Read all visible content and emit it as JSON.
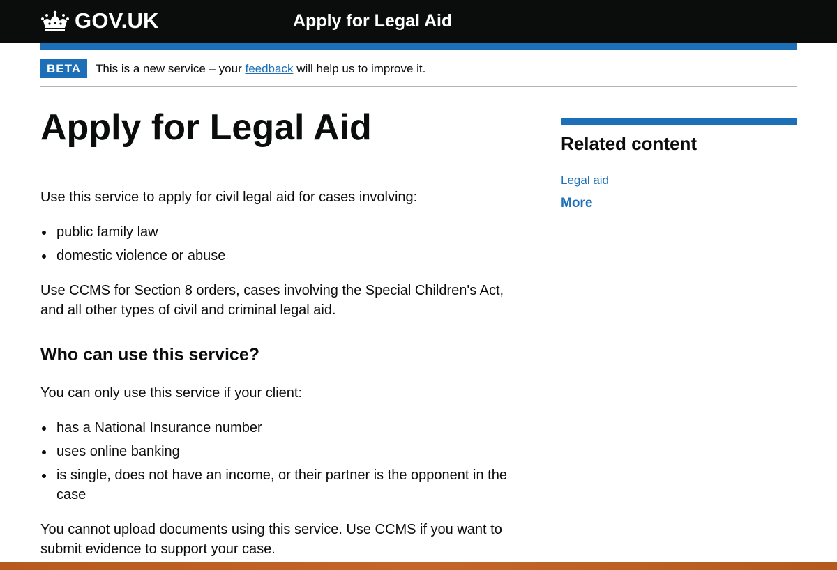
{
  "header": {
    "logo_text": "GOV.UK",
    "service_name": "Apply for Legal Aid"
  },
  "phase_banner": {
    "tag": "BETA",
    "text_before": "This is a new service – your ",
    "link": "feedback",
    "text_after": " will help us to improve it."
  },
  "main": {
    "title": "Apply for Legal Aid",
    "intro": "Use this service to apply for civil legal aid for cases involving:",
    "case_types": [
      "public family law",
      "domestic violence or abuse"
    ],
    "ccms_note": "Use CCMS for Section 8 orders, cases involving the Special Children's Act, and all other types of civil and criminal legal aid.",
    "who_heading": "Who can use this service?",
    "who_intro": "You can only use this service if your client:",
    "conditions": [
      "has a National Insurance number",
      "uses online banking",
      "is single, does not have an income, or their partner is the opponent in the case"
    ],
    "upload_note": "You cannot upload documents using this service. Use CCMS if you want to submit evidence to support your case."
  },
  "related": {
    "heading": "Related content",
    "links": [
      "Legal aid",
      "More"
    ]
  },
  "colors": {
    "header_bg": "#0b0c0c",
    "brand_blue": "#1d70b8",
    "text": "#0b0c0c",
    "link": "#1d70b8",
    "footer_strip": "#c4662a"
  }
}
